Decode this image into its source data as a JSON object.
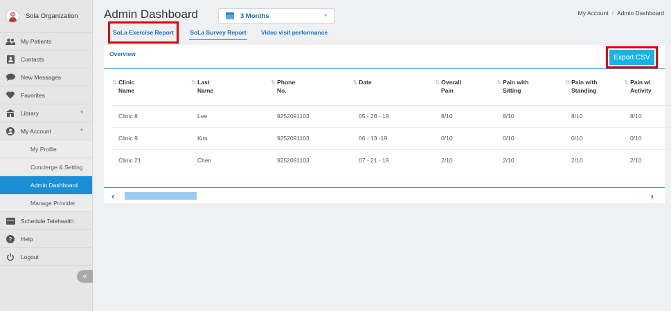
{
  "sidebar": {
    "org_name": "Sola Organization",
    "items": [
      {
        "label": "My Patients",
        "icon": "users-icon"
      },
      {
        "label": "Contacts",
        "icon": "contacts-icon"
      },
      {
        "label": "New Messages",
        "icon": "message-icon"
      },
      {
        "label": "Favorites",
        "icon": "heart-icon"
      },
      {
        "label": "Library",
        "icon": "library-icon"
      },
      {
        "label": "My Account",
        "icon": "account-icon"
      },
      {
        "label": "My Profile"
      },
      {
        "label": "Concierge & Setting"
      },
      {
        "label": "Admin Dashboard"
      },
      {
        "label": "Manage Provider"
      },
      {
        "label": "Schedule Telehealth",
        "icon": "calendar-icon"
      },
      {
        "label": "Help",
        "icon": "help-icon"
      },
      {
        "label": "Logout",
        "icon": "power-icon"
      }
    ],
    "collapse_label": "«"
  },
  "header": {
    "title": "Admin Dashboard",
    "range": "3 Months",
    "breadcrumb": [
      "My Account",
      "Admin Dashboard"
    ]
  },
  "tabs": [
    "SoLa Exercise Report",
    "SoLa Survey Report",
    "Video visit performance"
  ],
  "card": {
    "overview": "Overview",
    "export_label": "Export CSV"
  },
  "table": {
    "sort_glyph": "⇅",
    "columns": [
      [
        "Clinic",
        "Name"
      ],
      [
        "Last",
        "Name"
      ],
      [
        "Phone",
        "No."
      ],
      [
        "Date",
        ""
      ],
      [
        "Overall",
        "Pain"
      ],
      [
        "Pain with",
        "Sitting"
      ],
      [
        "Pain with",
        "Standing"
      ],
      [
        "Pain wi",
        "Activity"
      ]
    ],
    "rows": [
      [
        "Clinic 8",
        "Lee",
        "9252091103",
        "05 - 28 - 19",
        "8/10",
        "8/10",
        "8/10",
        "8/10"
      ],
      [
        "Clinic 9",
        "Kim",
        "9252091103",
        "06 - 13 -19",
        "0/10",
        "0/10",
        "0/10",
        "0/10"
      ],
      [
        "Clinic 21",
        "Chen",
        "9252091103",
        "07 - 21 - 19",
        "2/10",
        "2/10",
        "2/10",
        "2/10"
      ]
    ]
  },
  "scroll": {
    "left": "‹",
    "right": "›"
  },
  "colors": {
    "accent": "#1a8fd8",
    "highlight": "#e00000",
    "export": "#18b3e6"
  }
}
